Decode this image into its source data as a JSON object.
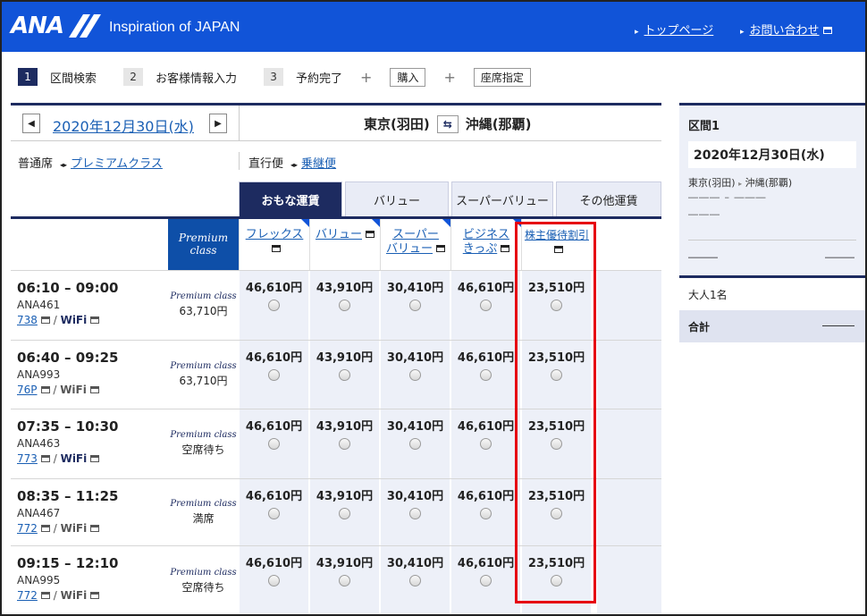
{
  "header": {
    "logo": "ANA",
    "tagline": "Inspiration of JAPAN",
    "links": [
      "トップページ",
      "お問い合わせ"
    ],
    "brand_color": "#1154d8"
  },
  "steps": [
    {
      "num": "1",
      "label": "区間検索",
      "active": true
    },
    {
      "num": "2",
      "label": "お客様情報入力",
      "active": false
    },
    {
      "num": "3",
      "label": "予約完了",
      "active": false
    }
  ],
  "extras": [
    "購入",
    "座席指定"
  ],
  "date_bar": {
    "date": "2020年12月30日(水)",
    "from": "東京(羽田)",
    "to": "沖縄(那覇)"
  },
  "class_row": {
    "current": "普通席",
    "other": "プレミアムクラス"
  },
  "route_row": {
    "current": "直行便",
    "other": "乗継便"
  },
  "tabs": [
    "おもな運賃",
    "バリュー",
    "スーパーバリュー",
    "その他運賃"
  ],
  "premium_head": [
    "Premium",
    "class"
  ],
  "fare_columns": [
    {
      "label1": "フレックス",
      "label2": ""
    },
    {
      "label1": "バリュー",
      "label2": ""
    },
    {
      "label1": "スーパー",
      "label2": "バリュー"
    },
    {
      "label1": "ビジネス",
      "label2": "きっぷ"
    },
    {
      "label1": "株主優待割引",
      "label2": ""
    }
  ],
  "premium_label": "Premium class",
  "flights": [
    {
      "time": "06:10 – 09:00",
      "num": "ANA461",
      "aircraft": "738",
      "wifi": "WiFi",
      "premium": "63,710円",
      "fares": [
        "46,610円",
        "43,910円",
        "30,410円",
        "46,610円",
        "23,510円"
      ]
    },
    {
      "time": "06:40 – 09:25",
      "num": "ANA993",
      "aircraft": "76P",
      "wifi": "WiFi",
      "premium": "63,710円",
      "fares": [
        "46,610円",
        "43,910円",
        "30,410円",
        "46,610円",
        "23,510円"
      ]
    },
    {
      "time": "07:35 – 10:30",
      "num": "ANA463",
      "aircraft": "773",
      "wifi": "WiFi",
      "premium": "空席待ち",
      "fares": [
        "46,610円",
        "43,910円",
        "30,410円",
        "46,610円",
        "23,510円"
      ]
    },
    {
      "time": "08:35 – 11:25",
      "num": "ANA467",
      "aircraft": "772",
      "wifi": "WiFi",
      "premium": "満席",
      "fares": [
        "46,610円",
        "43,910円",
        "30,410円",
        "46,610円",
        "23,510円"
      ]
    },
    {
      "time": "09:15 – 12:10",
      "num": "ANA995",
      "aircraft": "772",
      "wifi": "WiFi",
      "premium": "空席待ち",
      "fares": [
        "46,610円",
        "43,910円",
        "30,410円",
        "46,610円",
        "23,510円"
      ]
    }
  ],
  "sidebar": {
    "title": "区間1",
    "date": "2020年12月30日(水)",
    "from": "東京(羽田)",
    "to": "沖縄(那覇)",
    "dash1": "――― – ―――",
    "dash2": "―――",
    "row_left": "―――",
    "row_right": "―――",
    "adult": "大人1名",
    "total_label": "合計",
    "total_value": "―――"
  }
}
